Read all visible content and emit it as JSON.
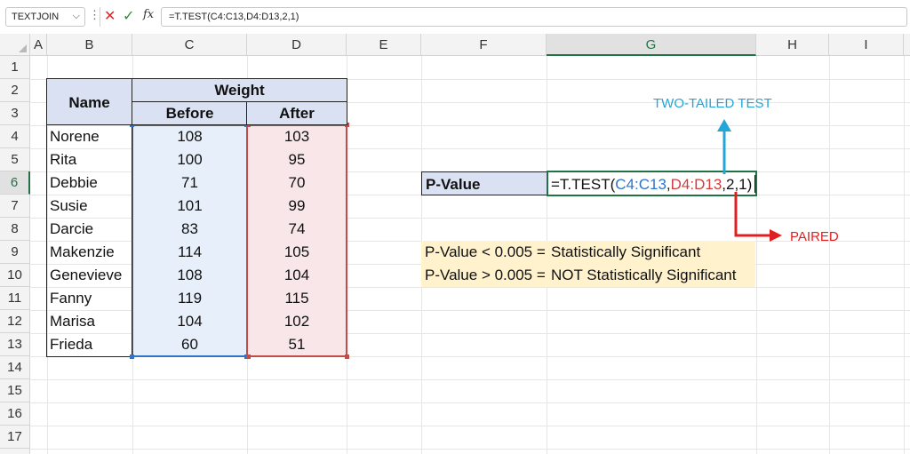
{
  "formula_bar": {
    "name_box": "TEXTJOIN",
    "dropdown_glyph": "⌵",
    "dots_glyph": "⋮",
    "cancel_glyph": "✕",
    "enter_glyph": "✓",
    "fx_label": "fx",
    "formula": "=T.TEST(C4:C13,D4:D13,2,1)"
  },
  "columns": [
    "A",
    "B",
    "C",
    "D",
    "E",
    "F",
    "G",
    "H",
    "I"
  ],
  "selected_column": "G",
  "rows": [
    "1",
    "2",
    "3",
    "4",
    "5",
    "6",
    "7",
    "8",
    "9",
    "10",
    "11",
    "12",
    "13",
    "14",
    "15",
    "16",
    "17"
  ],
  "selected_row": "6",
  "table": {
    "header_name": "Name",
    "header_weight": "Weight",
    "header_before": "Before",
    "header_after": "After",
    "records": [
      {
        "name": "Norene",
        "before": "108",
        "after": "103"
      },
      {
        "name": "Rita",
        "before": "100",
        "after": "95"
      },
      {
        "name": "Debbie",
        "before": "71",
        "after": "70"
      },
      {
        "name": "Susie",
        "before": "101",
        "after": "99"
      },
      {
        "name": "Darcie",
        "before": "83",
        "after": "74"
      },
      {
        "name": "Makenzie",
        "before": "114",
        "after": "105"
      },
      {
        "name": "Genevieve",
        "before": "108",
        "after": "104"
      },
      {
        "name": "Fanny",
        "before": "119",
        "after": "115"
      },
      {
        "name": "Marisa",
        "before": "104",
        "after": "102"
      },
      {
        "name": "Frieda",
        "before": "60",
        "after": "51"
      }
    ]
  },
  "pvalue": {
    "label": "P-Value",
    "formula_prefix": "=T.TEST(",
    "range_c": "C4:C13",
    "comma1": ",",
    "range_d": "D4:D13",
    "formula_suffix": ",2,1)"
  },
  "info": {
    "line1_condition": "P-Value < 0.005 =",
    "line1_result": "Statistically Significant",
    "line2_condition": "P-Value > 0.005 =",
    "line2_result": "NOT Statistically Significant"
  },
  "annotations": {
    "two_tailed": "TWO-TAILED TEST",
    "paired": "PAIRED",
    "two_tailed_color": "#22a6d8",
    "paired_color": "#e02020"
  },
  "colors": {
    "header_fill": "#d9e1f2",
    "before_range": "#2f74c9",
    "after_range": "#c54a4a",
    "info_fill": "#fff2cc",
    "excel_green": "#217346"
  }
}
